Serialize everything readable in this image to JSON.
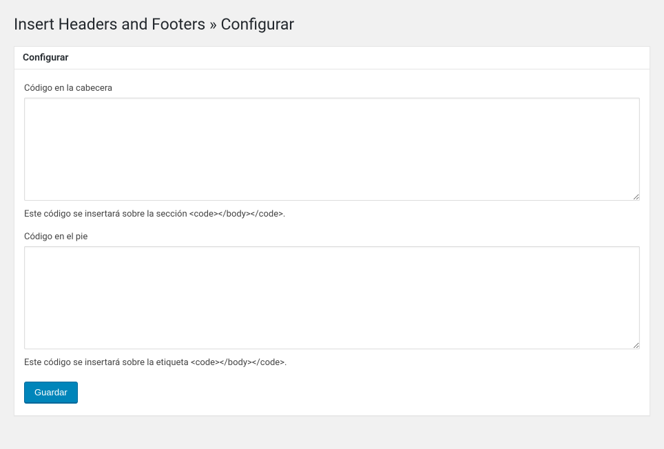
{
  "page": {
    "title": "Insert Headers and Footers » Configurar"
  },
  "panel": {
    "heading": "Configurar"
  },
  "fields": {
    "header": {
      "label": "Código en la cabecera",
      "value": "",
      "description": "Este código se insertará sobre la sección <code></body></code>."
    },
    "footer": {
      "label": "Código en el pie",
      "value": "",
      "description": "Este código se insertará sobre la etiqueta <code></body></code>."
    }
  },
  "actions": {
    "save_label": "Guardar"
  }
}
